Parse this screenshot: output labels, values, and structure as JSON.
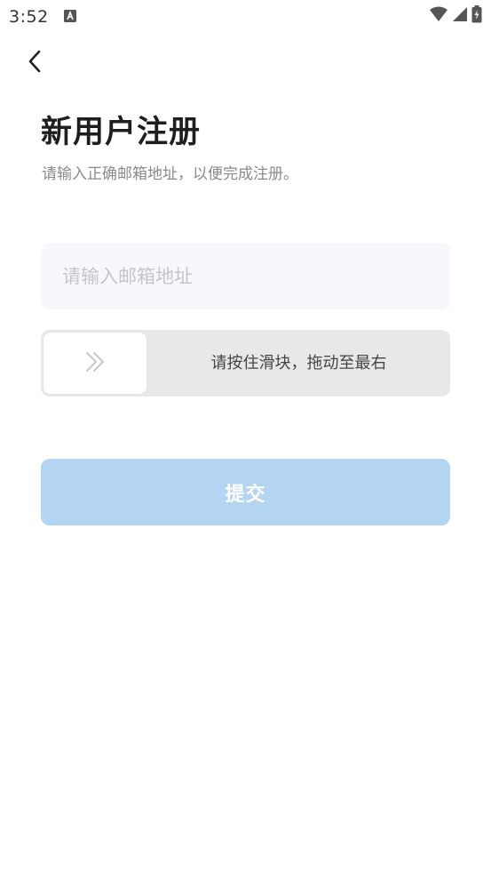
{
  "status_bar": {
    "time": "3:52",
    "icons": [
      "notification-a-icon",
      "wifi-icon",
      "signal-icon",
      "battery-charging-icon"
    ]
  },
  "nav": {
    "back_icon": "chevron-left-icon"
  },
  "header": {
    "title": "新用户注册",
    "subtitle": "请输入正确邮箱地址，以便完成注册。"
  },
  "form": {
    "email": {
      "value": "",
      "placeholder": "请输入邮箱地址"
    },
    "slider": {
      "handle_icon": "double-chevron-right-icon",
      "label": "请按住滑块，拖动至最右",
      "progress": 0
    },
    "submit_label": "提交"
  },
  "colors": {
    "input_bg": "#f6f8fc",
    "slider_track": "#e8e8e8",
    "submit_disabled": "#b4d5f1",
    "title_text": "#1e1e1e",
    "subtitle_text": "#8a8a8a"
  }
}
